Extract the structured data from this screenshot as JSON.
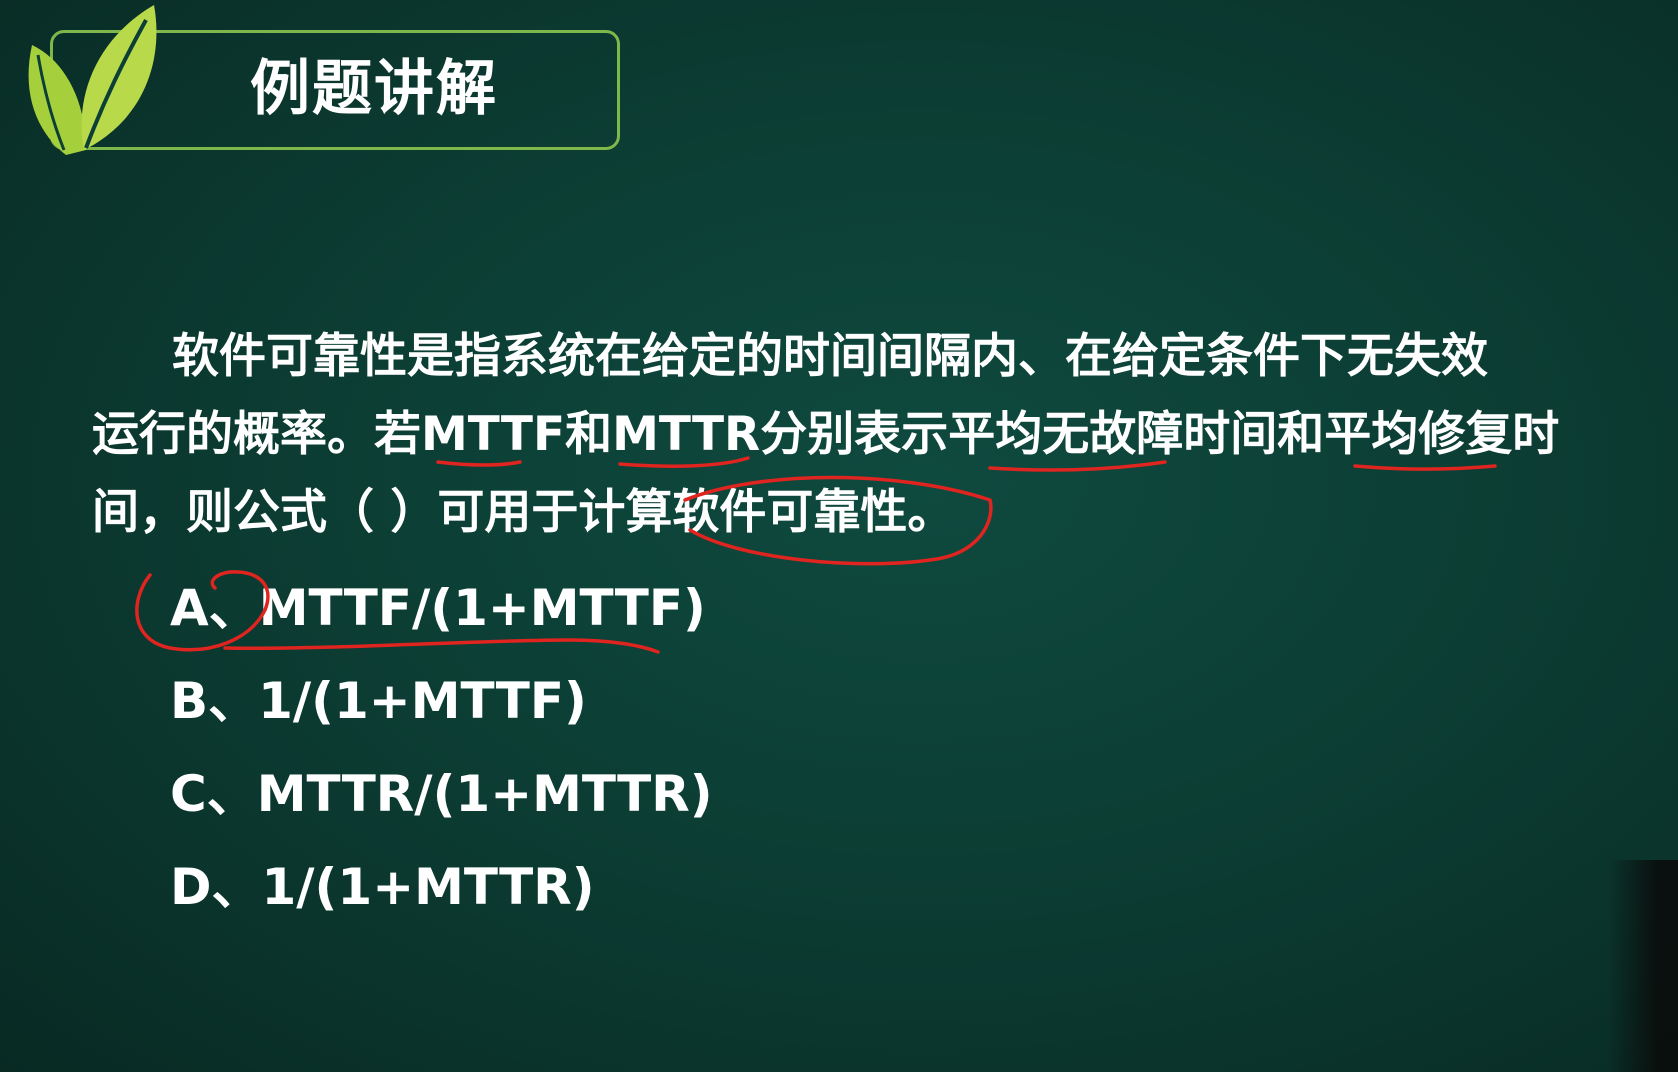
{
  "slide": {
    "title": "例题讲解",
    "question_lines": [
      "软件可靠性是指系统在给定的时间间隔内、在给定条件下无失效",
      "运行的概率。若MTTF和MTTR分别表示平均无故障时间和平均修复时",
      "间，则公式（ ）可用于计算软件可靠性。"
    ],
    "options": [
      {
        "label": "A、MTTF/(1+MTTF)"
      },
      {
        "label": "B、1/(1+MTTF)"
      },
      {
        "label": "C、MTTR/(1+MTTR)"
      },
      {
        "label": "D、1/(1+MTTR)"
      }
    ]
  },
  "colors": {
    "background": "#0c3f35",
    "frame_border": "#7fb84a",
    "leaf_green": "#a6cf3c",
    "annotation_red": "#e0241f",
    "text": "#ffffff"
  },
  "icons": {
    "logo": "leaf-logo-icon"
  }
}
